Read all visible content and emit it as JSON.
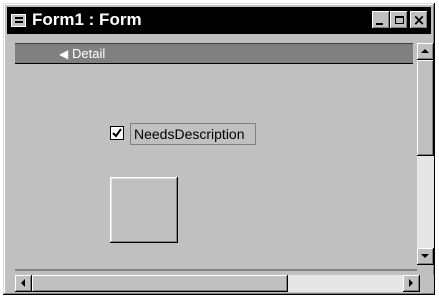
{
  "window": {
    "title": "Form1 : Form",
    "icon": "form-icon",
    "controls": {
      "minimize": "minimize-icon",
      "maximize": "maximize-icon",
      "close": "×"
    }
  },
  "section": {
    "icon": "section-arrow-icon",
    "label": "Detail"
  },
  "form": {
    "checkbox": {
      "label": "NeedsDescription",
      "checked": true
    },
    "command_button": {
      "label": ""
    }
  },
  "scrollbars": {
    "vertical": {
      "up": "up-arrow-icon",
      "down": "down-arrow-icon"
    },
    "horizontal": {
      "left": "left-arrow-icon",
      "right": "right-arrow-icon"
    }
  }
}
